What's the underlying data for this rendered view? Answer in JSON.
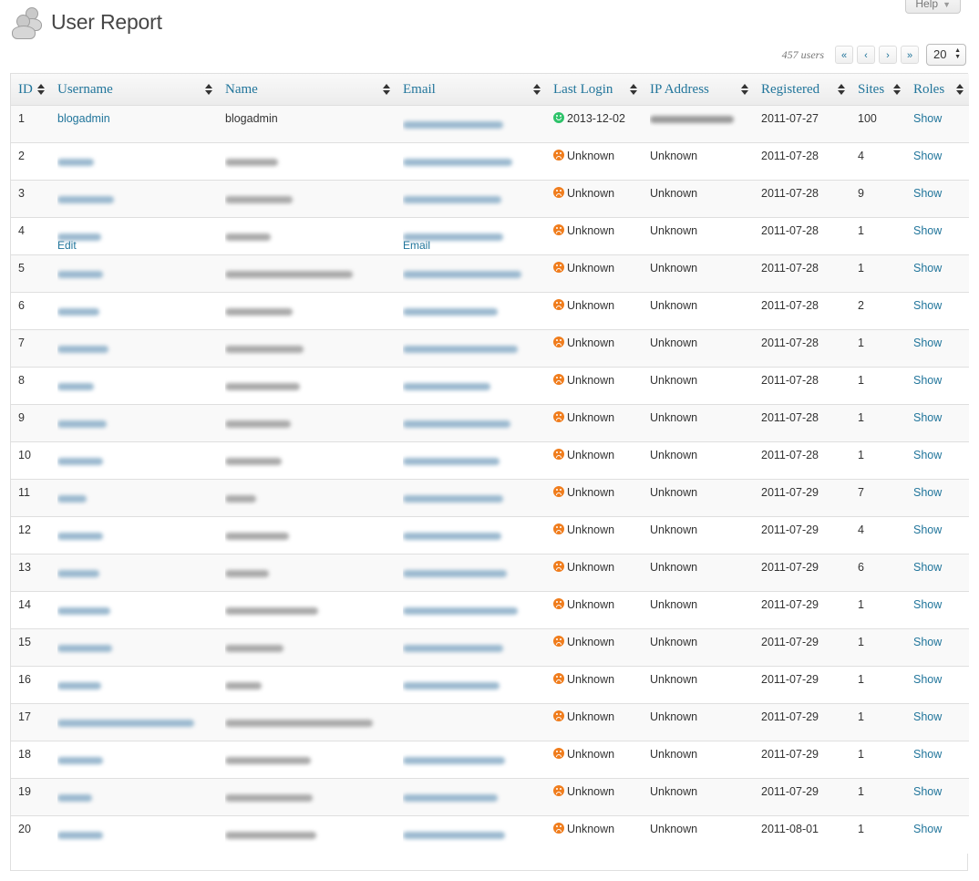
{
  "page": {
    "title": "User Report",
    "help_label": "Help",
    "user_count": "457 users"
  },
  "pagination": {
    "first": "«",
    "prev": "‹",
    "next": "›",
    "last": "»",
    "per_page": "20"
  },
  "columns": [
    "ID",
    "Username",
    "Name",
    "Email",
    "Last Login",
    "IP Address",
    "Registered",
    "Sites",
    "Roles"
  ],
  "row_actions": {
    "edit": "Edit",
    "email": "Email"
  },
  "rows": [
    {
      "id": "1",
      "username": "blogadmin",
      "name": "blogadmin",
      "last_login": "2013-12-02",
      "login_status": "happy",
      "ip": "",
      "registered": "2011-07-27",
      "sites": "100",
      "roles": "Show"
    },
    {
      "id": "2",
      "username": "",
      "name": "",
      "last_login": "Unknown",
      "login_status": "sad",
      "ip": "Unknown",
      "registered": "2011-07-28",
      "sites": "4",
      "roles": "Show"
    },
    {
      "id": "3",
      "username": "",
      "name": "",
      "last_login": "Unknown",
      "login_status": "sad",
      "ip": "Unknown",
      "registered": "2011-07-28",
      "sites": "9",
      "roles": "Show"
    },
    {
      "id": "4",
      "username": "",
      "name": "",
      "last_login": "Unknown",
      "login_status": "sad",
      "ip": "Unknown",
      "registered": "2011-07-28",
      "sites": "1",
      "roles": "Show"
    },
    {
      "id": "5",
      "username": "",
      "name": "",
      "last_login": "Unknown",
      "login_status": "sad",
      "ip": "Unknown",
      "registered": "2011-07-28",
      "sites": "1",
      "roles": "Show"
    },
    {
      "id": "6",
      "username": "",
      "name": "",
      "last_login": "Unknown",
      "login_status": "sad",
      "ip": "Unknown",
      "registered": "2011-07-28",
      "sites": "2",
      "roles": "Show"
    },
    {
      "id": "7",
      "username": "",
      "name": "",
      "last_login": "Unknown",
      "login_status": "sad",
      "ip": "Unknown",
      "registered": "2011-07-28",
      "sites": "1",
      "roles": "Show"
    },
    {
      "id": "8",
      "username": "",
      "name": "",
      "last_login": "Unknown",
      "login_status": "sad",
      "ip": "Unknown",
      "registered": "2011-07-28",
      "sites": "1",
      "roles": "Show"
    },
    {
      "id": "9",
      "username": "",
      "name": "",
      "last_login": "Unknown",
      "login_status": "sad",
      "ip": "Unknown",
      "registered": "2011-07-28",
      "sites": "1",
      "roles": "Show"
    },
    {
      "id": "10",
      "username": "",
      "name": "",
      "last_login": "Unknown",
      "login_status": "sad",
      "ip": "Unknown",
      "registered": "2011-07-28",
      "sites": "1",
      "roles": "Show"
    },
    {
      "id": "11",
      "username": "",
      "name": "",
      "last_login": "Unknown",
      "login_status": "sad",
      "ip": "Unknown",
      "registered": "2011-07-29",
      "sites": "7",
      "roles": "Show"
    },
    {
      "id": "12",
      "username": "",
      "name": "",
      "last_login": "Unknown",
      "login_status": "sad",
      "ip": "Unknown",
      "registered": "2011-07-29",
      "sites": "4",
      "roles": "Show"
    },
    {
      "id": "13",
      "username": "",
      "name": "",
      "last_login": "Unknown",
      "login_status": "sad",
      "ip": "Unknown",
      "registered": "2011-07-29",
      "sites": "6",
      "roles": "Show"
    },
    {
      "id": "14",
      "username": "",
      "name": "",
      "last_login": "Unknown",
      "login_status": "sad",
      "ip": "Unknown",
      "registered": "2011-07-29",
      "sites": "1",
      "roles": "Show"
    },
    {
      "id": "15",
      "username": "",
      "name": "",
      "last_login": "Unknown",
      "login_status": "sad",
      "ip": "Unknown",
      "registered": "2011-07-29",
      "sites": "1",
      "roles": "Show"
    },
    {
      "id": "16",
      "username": "",
      "name": "",
      "last_login": "Unknown",
      "login_status": "sad",
      "ip": "Unknown",
      "registered": "2011-07-29",
      "sites": "1",
      "roles": "Show"
    },
    {
      "id": "17",
      "username": "",
      "name": "",
      "last_login": "Unknown",
      "login_status": "sad",
      "ip": "Unknown",
      "registered": "2011-07-29",
      "sites": "1",
      "roles": "Show"
    },
    {
      "id": "18",
      "username": "",
      "name": "",
      "last_login": "Unknown",
      "login_status": "sad",
      "ip": "Unknown",
      "registered": "2011-07-29",
      "sites": "1",
      "roles": "Show"
    },
    {
      "id": "19",
      "username": "",
      "name": "",
      "last_login": "Unknown",
      "login_status": "sad",
      "ip": "Unknown",
      "registered": "2011-07-29",
      "sites": "1",
      "roles": "Show"
    },
    {
      "id": "20",
      "username": "",
      "name": "",
      "last_login": "Unknown",
      "login_status": "sad",
      "ip": "Unknown",
      "registered": "2011-08-01",
      "sites": "1",
      "roles": "Show"
    }
  ],
  "colors": {
    "link": "#21759b",
    "status_unknown": "#f07d1d",
    "status_active": "#2ec36a"
  },
  "icons": {
    "page": "users-icon",
    "login_happy": "happy-face-icon",
    "login_sad": "sad-face-icon"
  }
}
